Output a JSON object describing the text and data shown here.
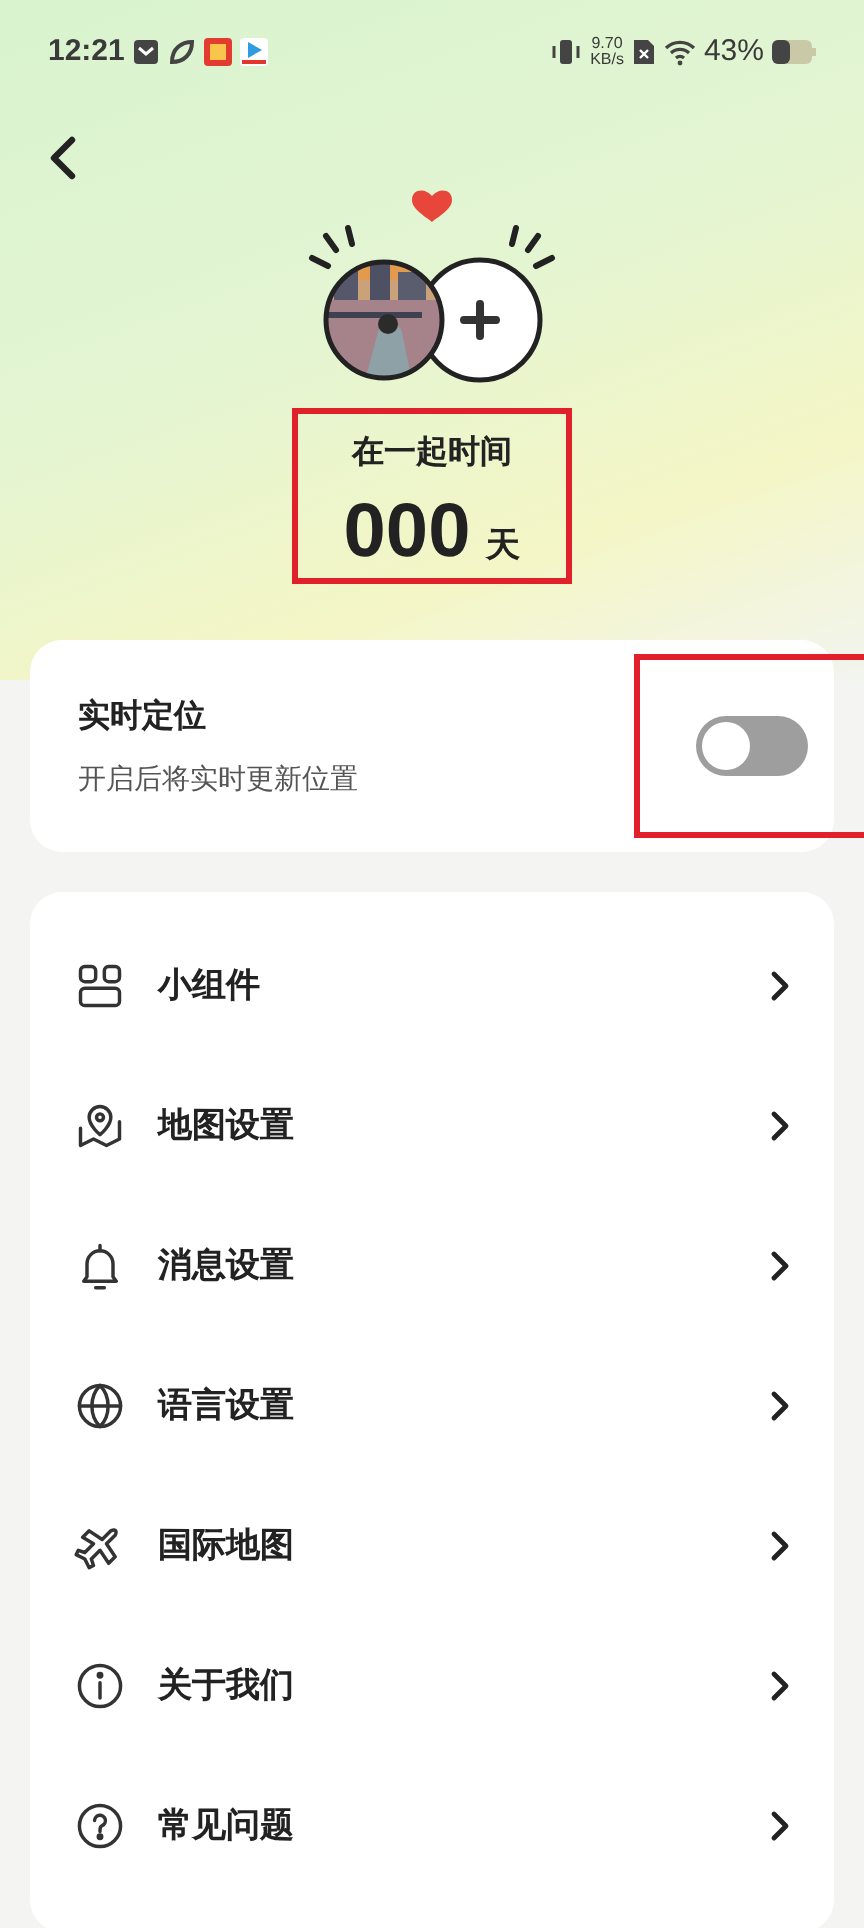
{
  "status_bar": {
    "time": "12:21",
    "net_speed": "9.70",
    "net_unit": "KB/s",
    "battery": "43%"
  },
  "together": {
    "label": "在一起时间",
    "days": "000",
    "unit": "天"
  },
  "realtime_location": {
    "title": "实时定位",
    "subtitle": "开启后将实时更新位置",
    "on": false
  },
  "menu": [
    {
      "kind": "widget",
      "label": "小组件"
    },
    {
      "kind": "map",
      "label": "地图设置"
    },
    {
      "kind": "bell",
      "label": "消息设置"
    },
    {
      "kind": "globe",
      "label": "语言设置"
    },
    {
      "kind": "plane",
      "label": "国际地图"
    },
    {
      "kind": "info",
      "label": "关于我们"
    },
    {
      "kind": "help",
      "label": "常见问题"
    }
  ]
}
